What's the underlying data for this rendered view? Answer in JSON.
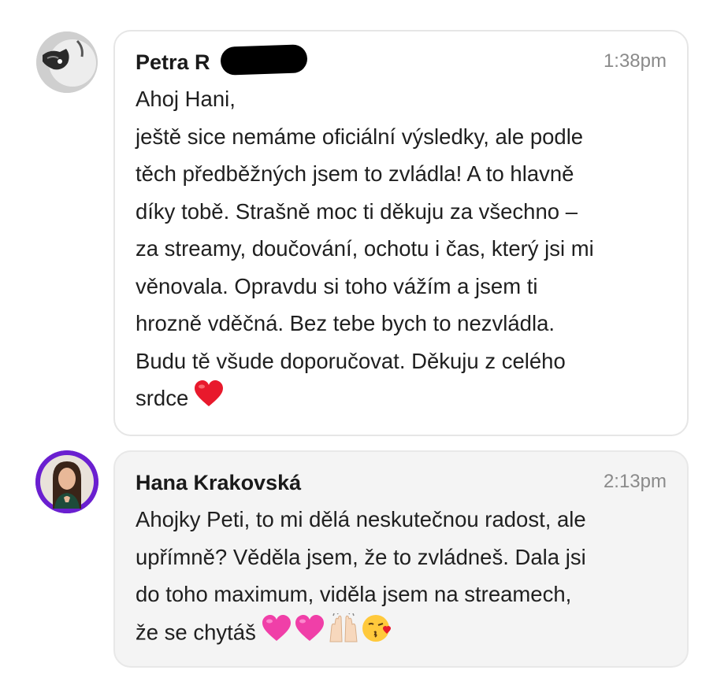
{
  "messages": [
    {
      "sender": "Petra R",
      "time": "1:38pm",
      "lines": [
        "Ahoj Hani,",
        "ještě sice nemáme oficiální výsledky, ale podle",
        "těch předběžných jsem to zvládla! A to hlavně",
        "díky tobě. Strašně moc ti děkuju za všechno –",
        "za streamy, doučování, ochotu i čas, který jsi mi",
        "věnovala. Opravdu si toho vážím a jsem ti",
        "hrozně vděčná. Bez tebe bych to nezvládla.",
        "Budu tě všude doporučovat. Děkuju z celého",
        "srdce"
      ],
      "trailing_emojis": [
        "red-heart"
      ]
    },
    {
      "sender": "Hana Krakovská",
      "time": "2:13pm",
      "lines": [
        "Ahojky Peti, to mi dělá neskutečnou radost, ale",
        "upřímně? Věděla jsem, že to zvládneš. Dala jsi",
        "do toho maximum, viděla jsem na streamech,",
        "že se chytáš"
      ],
      "trailing_emojis": [
        "pink-heart",
        "pink-heart",
        "raising-hands",
        "face-blowing-kiss"
      ]
    }
  ],
  "colors": {
    "bubble_border": "#e6e6e6",
    "hana_bubble_bg": "#f4f4f4",
    "hana_avatar_ring": "#6a1fd0",
    "heart_red": "#e8192c",
    "heart_pink": "#f03fa8",
    "timestamp": "#8a8a8a"
  }
}
